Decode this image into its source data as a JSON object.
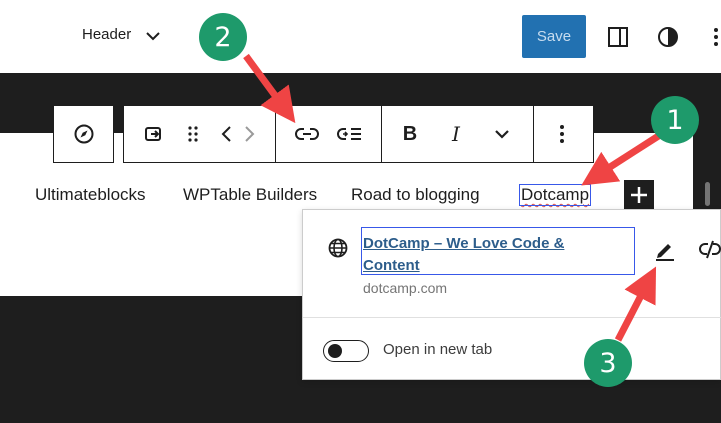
{
  "header": {
    "template_name": "Header",
    "save_label": "Save",
    "icons": [
      "chevron-down-icon",
      "sidebar-panel-icon",
      "styles-contrast-icon",
      "more-vertical-icon"
    ]
  },
  "toolbar": {
    "icons": [
      "compass-icon",
      "link-block-icon",
      "drag-handle-icon",
      "move-left-icon",
      "move-right-icon",
      "link-icon",
      "submenu-icon",
      "bold-icon",
      "italic-icon",
      "more-rich-text-chevron-icon",
      "block-options-icon"
    ],
    "bold_label": "B",
    "italic_label": "I"
  },
  "navigation": {
    "items": [
      {
        "label": "Ultimateblocks"
      },
      {
        "label": "WPTable Builders"
      },
      {
        "label": "Road to blogging"
      },
      {
        "label": "Dotcamp"
      }
    ],
    "add_icon": "plus-icon"
  },
  "link_popover": {
    "title": "DotCamp – We Love Code & Content",
    "url": "dotcamp.com",
    "new_tab_label": "Open in new tab",
    "new_tab_enabled": false,
    "icons": [
      "globe-icon",
      "edit-pencil-icon",
      "unlink-icon"
    ]
  },
  "annotations": {
    "badges": [
      "1",
      "2",
      "3"
    ]
  },
  "colors": {
    "accent": "#3858e9",
    "save_button": "#2271b1",
    "badge": "#1e9a6b",
    "arrow": "#ef4444",
    "dark": "#1e1e1e"
  }
}
